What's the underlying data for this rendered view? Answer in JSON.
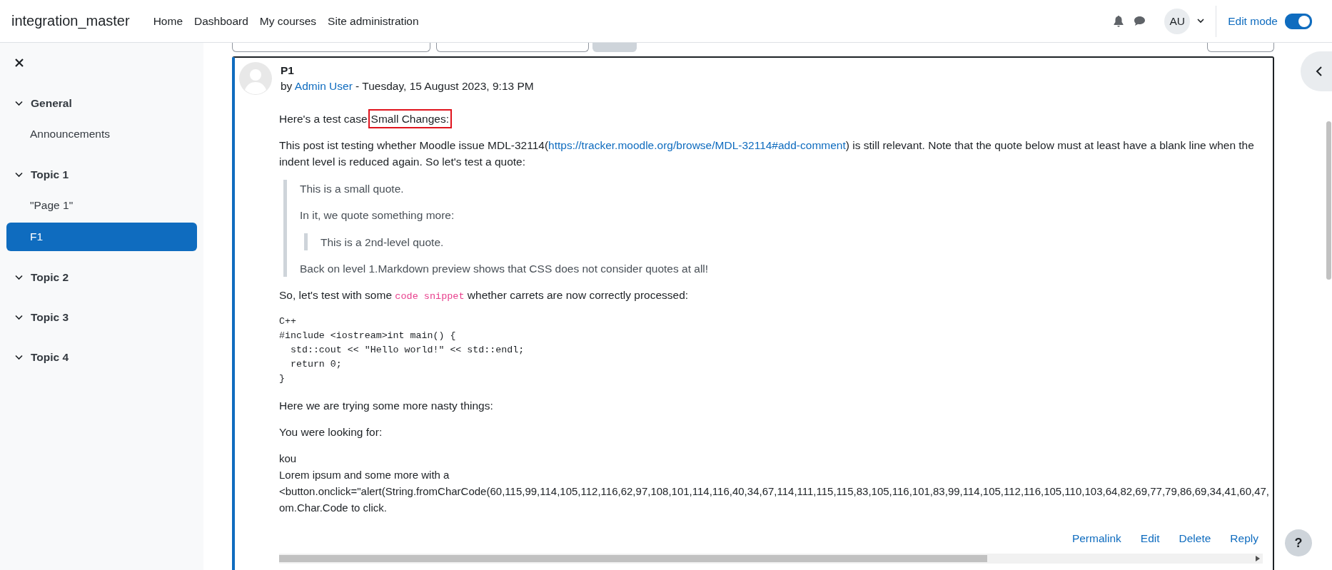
{
  "header": {
    "site_name": "integration_master",
    "nav": [
      {
        "label": "Home"
      },
      {
        "label": "Dashboard"
      },
      {
        "label": "My courses"
      },
      {
        "label": "Site administration"
      }
    ],
    "avatar_initials": "AU",
    "edit_mode": {
      "label": "Edit mode",
      "on": true
    }
  },
  "sidebar": {
    "sections": [
      {
        "title": "General",
        "expanded": true,
        "children": [
          {
            "label": "Announcements",
            "selected": false
          }
        ]
      },
      {
        "title": "Topic 1",
        "expanded": true,
        "children": [
          {
            "label": "\"Page 1\"",
            "selected": false
          },
          {
            "label": "F1",
            "selected": true
          }
        ]
      },
      {
        "title": "Topic 2",
        "expanded": true
      },
      {
        "title": "Topic 3",
        "expanded": true
      },
      {
        "title": "Topic 4",
        "expanded": true
      }
    ]
  },
  "post": {
    "title": "P1",
    "byline": {
      "prefix": "by",
      "author": "Admin User",
      "date": "- Tuesday, 15 August 2023, 9:13 PM"
    },
    "body": [
      {
        "kind": "highlight",
        "text": "Here's a test case",
        "highlighted": "Small Changes:"
      },
      {
        "kind": "link",
        "before": "This post ist testing whether Moodle issue MDL-32114(",
        "link": "https://tracker.moodle.org/browse/MDL-32114#add-comment",
        "after": ") is still relevant. Note that the quote below must at least have a blank line when the indent level is reduced again. So let's test a quote:"
      },
      {
        "kind": "quote",
        "children": [
          {
            "kind": "para",
            "text": "This is a small quote."
          },
          {
            "kind": "para",
            "text": "In it, we quote something more:"
          },
          {
            "kind": "quote",
            "children": [
              {
                "kind": "para",
                "text": "This is a 2nd-level quote."
              }
            ]
          },
          {
            "kind": "para",
            "text": "Back on level 1.Markdown preview shows that CSS does not consider quotes at all!"
          }
        ]
      },
      {
        "kind": "code",
        "before": "So, let's test with some",
        "code": "code snippet",
        "after": "whether carrets are now correctly processed:"
      },
      {
        "kind": "pre",
        "lines": [
          "C++",
          "#include <iostream>int main() {",
          "  std::cout << \"Hello world!\" << std::endl;",
          "  return 0;",
          "}"
        ]
      },
      {
        "kind": "para",
        "text": "Here we are trying some more nasty things:"
      },
      {
        "kind": "para",
        "text": "You were looking for:"
      },
      {
        "kind": "lines",
        "lines": [
          "kou",
          "Lorem ipsum and some more with a",
          "<button.onclick=\"alert(String.fromCharCode(60,115,99,114,105,112,116,62,97,108,101,114,116,40,34,67,114,111,115,115,83,105,116,101,83,99,114,105,112,116,105,110,103,64,82,69,77,79,86,69,34,41,60,47,",
          "om.Char.Code to click."
        ]
      }
    ],
    "actions": [
      {
        "label": "Permalink"
      },
      {
        "label": "Edit"
      },
      {
        "label": "Delete"
      },
      {
        "label": "Reply"
      }
    ]
  },
  "help_button": {
    "label": "?"
  }
}
